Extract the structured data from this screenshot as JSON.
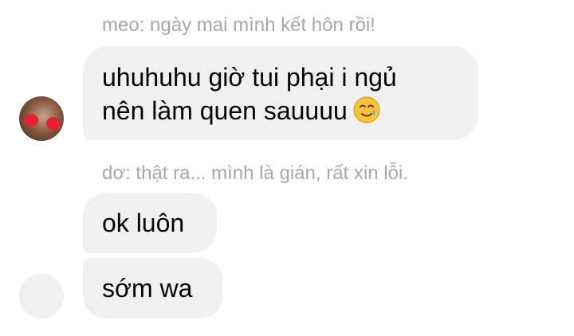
{
  "messages": [
    {
      "reply_to": "meo: ngày mai mình kết hôn rồi!",
      "lines": [
        "uhuhuhu giờ tui phại i ngủ",
        "nên làm quen sauuuu"
      ],
      "emoji": "smiling-face-with-tear-icon"
    },
    {
      "reply_to": "dơ: thật ra... mình là gián, rất xin lỗi.",
      "text": "ok luôn"
    },
    {
      "text": "sớm wa"
    }
  ],
  "colors": {
    "bubble": "#f0f0f0",
    "reply_label": "#a4a8ad",
    "message_text": "#050505"
  }
}
